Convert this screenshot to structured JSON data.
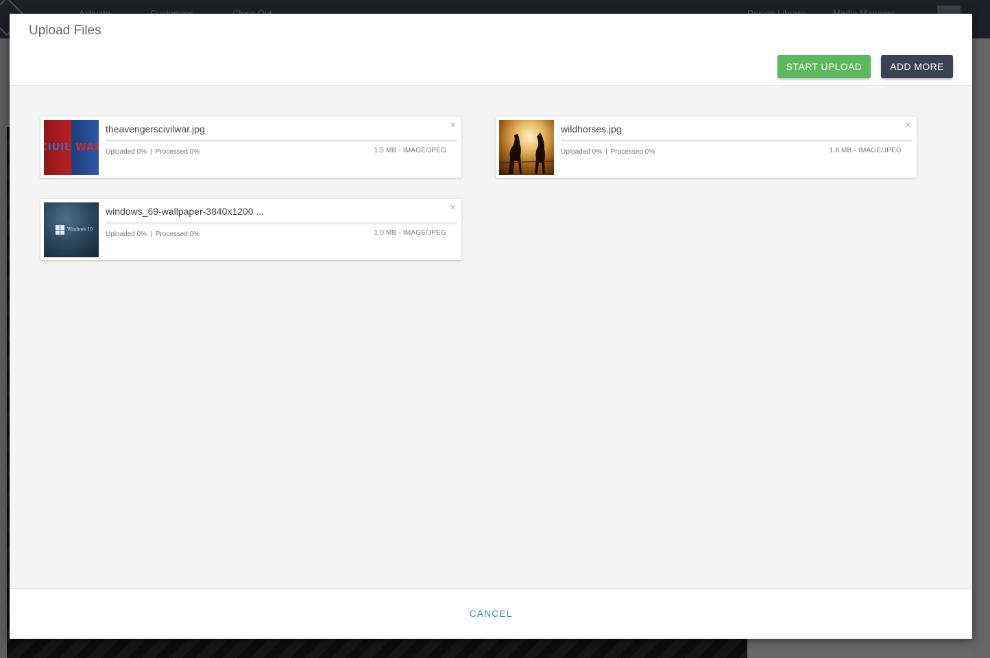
{
  "background": {
    "nav_items": [
      "Activate",
      "Customers",
      "Close Out"
    ],
    "right_nav_items": [
      "Design Library",
      "Media Manager"
    ]
  },
  "modal": {
    "title": "Upload Files",
    "start_upload_label": "START UPLOAD",
    "add_more_label": "ADD MORE",
    "cancel_label": "CANCEL"
  },
  "files": [
    {
      "name": "theavengerscivilwar.jpg",
      "uploaded": "Uploaded 0%",
      "processed": "Processed 0%",
      "meta": "1.5 MB - IMAGE/JPEG",
      "progress": 0,
      "thumb_text_left": "CIUIL",
      "thumb_text_right": "WAR"
    },
    {
      "name": "wildhorses.jpg",
      "uploaded": "Uploaded 0%",
      "processed": "Processed 0%",
      "meta": "1.8 MB - IMAGE/JPEG",
      "progress": 0
    },
    {
      "name": "windows_69-wallpaper-3840x1200 ...",
      "uploaded": "Uploaded 0%",
      "processed": "Processed 0%",
      "meta": "1.0 MB - IMAGE/JPEG",
      "progress": 0,
      "thumb_text": "Windows 10"
    }
  ],
  "separator": "|",
  "close_glyph": "×",
  "colors": {
    "primary_green": "#5cb85c",
    "dark_button": "#3b4253",
    "link_blue": "#3a88c4"
  }
}
